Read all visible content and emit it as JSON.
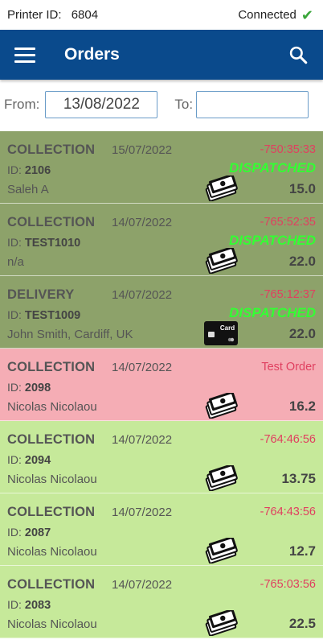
{
  "status_bar": {
    "printer_label": "Printer ID:",
    "printer_id": "6804",
    "connection": "Connected"
  },
  "header": {
    "title": "Orders"
  },
  "filters": {
    "from_label": "From:",
    "from_value": "13/08/2022",
    "to_label": "To:",
    "to_value": ""
  },
  "orders": [
    {
      "type": "COLLECTION",
      "date": "15/07/2022",
      "id_label": "ID:",
      "id": "2106",
      "customer": "Saleh A",
      "timer": "-750:35:33",
      "status": "DISPATCHED",
      "total": "15.0",
      "payment": "cash-icon",
      "state": "dispatched"
    },
    {
      "type": "COLLECTION",
      "date": "14/07/2022",
      "id_label": "ID:",
      "id": "TEST1010",
      "customer": "n/a",
      "timer": "-765:52:35",
      "status": "DISPATCHED",
      "total": "22.0",
      "payment": "cash-icon",
      "state": "dispatched"
    },
    {
      "type": "DELIVERY",
      "date": "14/07/2022",
      "id_label": "ID:",
      "id": "TEST1009",
      "customer": "John Smith, Cardiff, UK",
      "timer": "-765:12:37",
      "status": "DISPATCHED",
      "total": "22.0",
      "payment": "card-icon",
      "card_text": "Card",
      "state": "dispatched"
    },
    {
      "type": "COLLECTION",
      "date": "14/07/2022",
      "id_label": "ID:",
      "id": "2098",
      "customer": "Nicolas Nicolaou",
      "timer": "Test Order",
      "status": "",
      "total": "16.2",
      "payment": "cash-icon",
      "state": "test"
    },
    {
      "type": "COLLECTION",
      "date": "14/07/2022",
      "id_label": "ID:",
      "id": "2094",
      "customer": "Nicolas Nicolaou",
      "timer": "-764:46:56",
      "status": "",
      "total": "13.75",
      "payment": "cash-icon",
      "state": "new"
    },
    {
      "type": "COLLECTION",
      "date": "14/07/2022",
      "id_label": "ID:",
      "id": "2087",
      "customer": "Nicolas Nicolaou",
      "timer": "-764:43:56",
      "status": "",
      "total": "12.7",
      "payment": "cash-icon",
      "state": "new"
    },
    {
      "type": "COLLECTION",
      "date": "14/07/2022",
      "id_label": "ID:",
      "id": "2083",
      "customer": "Nicolas Nicolaou",
      "timer": "-765:03:56",
      "status": "",
      "total": "22.5",
      "payment": "cash-icon",
      "state": "new"
    }
  ],
  "colors": {
    "header": "#0a4a8c",
    "dispatched_bg": "#8da26a",
    "test_bg": "#f5adb5",
    "new_bg": "#c6e99a",
    "dispatched_text": "#33ff33",
    "timer_text": "#e04060"
  }
}
